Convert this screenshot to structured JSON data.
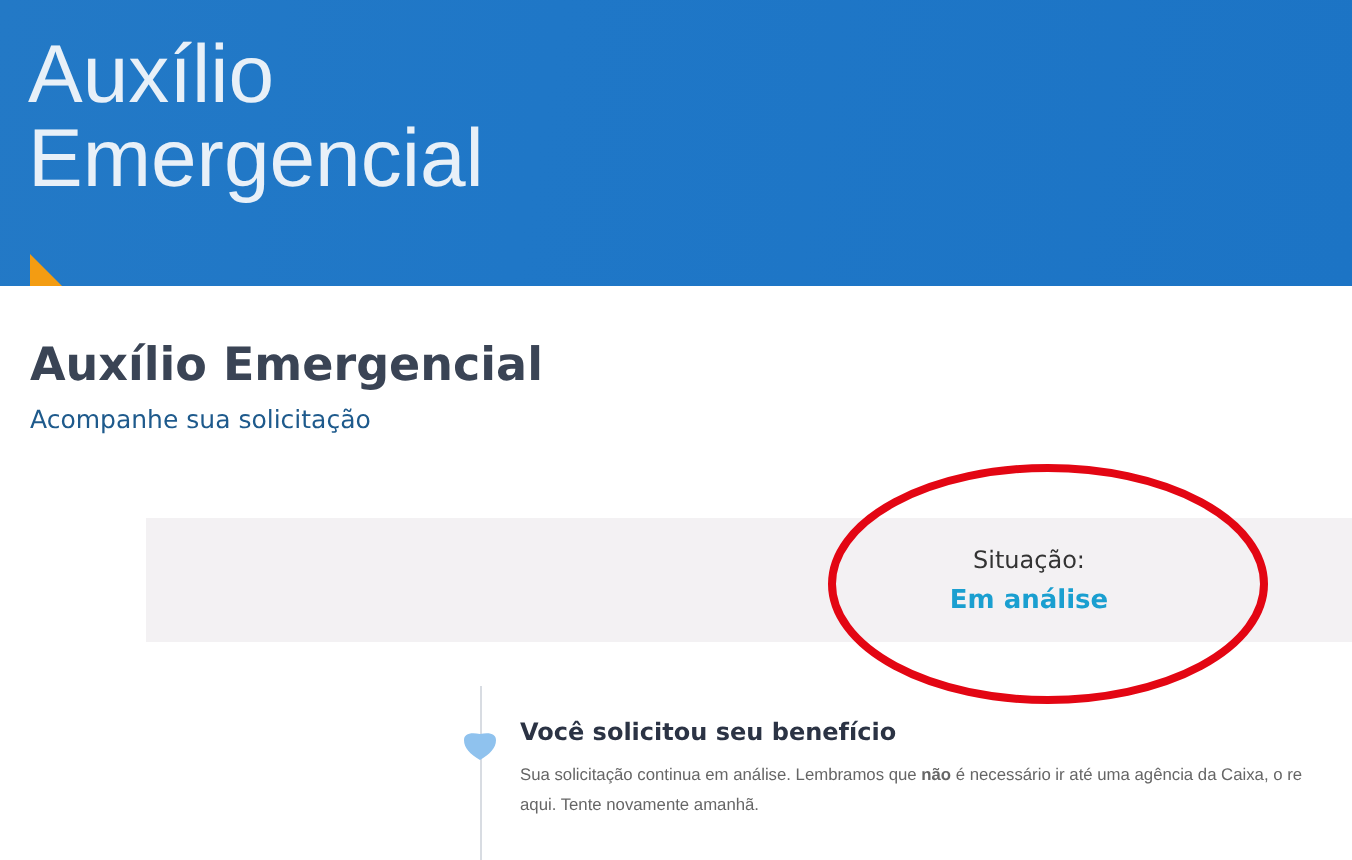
{
  "banner": {
    "title_lines": [
      "Auxílio",
      "Emergencial"
    ]
  },
  "page": {
    "heading": "Auxílio Emergencial",
    "subtitle": "Acompanhe sua solicitação"
  },
  "status": {
    "label": "Situação:",
    "value": "Em análise"
  },
  "timeline": [
    {
      "title": "Você solicitou seu benefício",
      "lines": [
        "Sua solicitação continua em análise. Lembramos que **não** é necessário ir até uma agência da Caixa, o re",
        "aqui. Tente novamente amanhã."
      ]
    }
  ]
}
